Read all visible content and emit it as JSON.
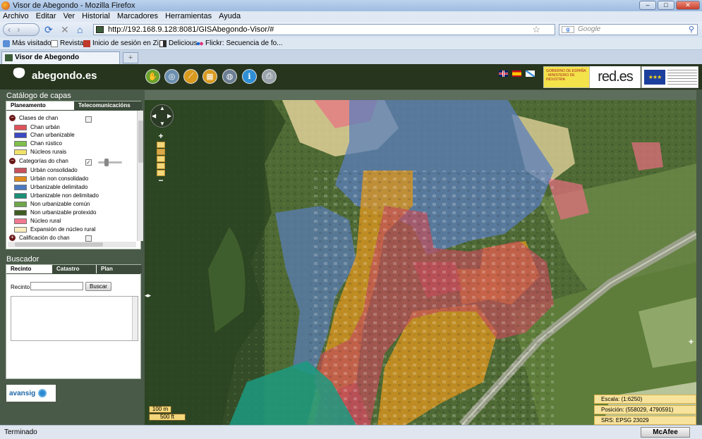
{
  "window": {
    "title": "Visor de Abegondo - Mozilla Firefox",
    "min": "–",
    "max": "□",
    "close": "✕"
  },
  "menu": [
    "Archivo",
    "Editar",
    "Ver",
    "Historial",
    "Marcadores",
    "Herramientas",
    "Ayuda"
  ],
  "nav": {
    "back_forward": "‹ ›",
    "reload": "⟳",
    "stop": "✕",
    "home": "⌂",
    "url": "http://192.168.9.128:8081/GISAbegondo-Visor/#",
    "star": "☆",
    "search_placeholder": "Google",
    "search_icon": "⚲"
  },
  "bookmarks": [
    {
      "label": "Más visitados",
      "icon": "bookmark-icon",
      "color": "#5b8fd6"
    },
    {
      "label": "Revistas",
      "icon": "page-icon",
      "color": "#eeeeee"
    },
    {
      "label": "Inicio de sesión en Zi...",
      "icon": "zimbra-icon",
      "color": "#c0392b"
    },
    {
      "label": "Delicious",
      "icon": "delicious-icon",
      "color": "#2a2a2a"
    },
    {
      "label": "Flickr: Secuencia de fo...",
      "icon": "flickr-icon",
      "color": "#e0317c"
    }
  ],
  "tab": {
    "label": "Visor de Abegondo",
    "new_tab": "+"
  },
  "app": {
    "logo": "abegondo.es",
    "tools": [
      {
        "name": "pan-hand-tool",
        "color": "#6aa32d",
        "glyph": "✋"
      },
      {
        "name": "overview-tool",
        "color": "#6c8faf",
        "glyph": "◎"
      },
      {
        "name": "measure-line-tool",
        "color": "#d99a1e",
        "glyph": "⟋"
      },
      {
        "name": "measure-area-tool",
        "color": "#d99a1e",
        "glyph": "▦"
      },
      {
        "name": "globe-tool",
        "color": "#6c7f94",
        "glyph": "◍"
      },
      {
        "name": "info-tool",
        "color": "#2f8fd6",
        "glyph": "i"
      },
      {
        "name": "print-tool",
        "color": "#9aa3ab",
        "glyph": "⎙"
      }
    ],
    "sponsor_gob": "GOBIERNO DE ESPAÑA · MINISTERIO DE INDUSTRIA",
    "sponsor_redes": "red.es",
    "sponsor_eu_stars": "★★★"
  },
  "catalog": {
    "title": "Catálogo de capas",
    "tabs": [
      "Planeamento",
      "Telecomunicacións"
    ],
    "groups": [
      {
        "label": "Clases de chan",
        "checked": false,
        "items": [
          {
            "label": "Chan urbán",
            "color": "#e0525a"
          },
          {
            "label": "Chan urbanizable",
            "color": "#3b49c4"
          },
          {
            "label": "Chan rústico",
            "color": "#7fc04a"
          },
          {
            "label": "Núcleos rurais",
            "color": "#f0e36a"
          }
        ]
      },
      {
        "label": "Categorías do chan",
        "checked": true,
        "items": [
          {
            "label": "Urbán consolidado",
            "color": "#c9515a"
          },
          {
            "label": "Urbán non consolidado",
            "color": "#e08a1c"
          },
          {
            "label": "Urbanizable delimitado",
            "color": "#4a79c0"
          },
          {
            "label": "Urbanizable non delimitado",
            "color": "#1a8f76"
          },
          {
            "label": "Non urbanizable común",
            "color": "#6fa64a"
          },
          {
            "label": "Non urbanizable protexido",
            "color": "#3d5c22"
          },
          {
            "label": "Núcleo rural",
            "color": "#f07890"
          },
          {
            "label": "Expansión de núcleo rural",
            "color": "#fbeec0"
          }
        ]
      },
      {
        "label": "Calificación do chan",
        "checked": false,
        "items": []
      }
    ]
  },
  "search": {
    "title": "Buscador",
    "tabs": [
      "Recinto",
      "Catastro",
      "Plan"
    ],
    "field_label": "Recinto",
    "field_value": "",
    "button": "Buscar"
  },
  "brand": {
    "label": "avansig"
  },
  "map": {
    "collapse": "◂▸",
    "pan_glyphs": {
      "up": "▲",
      "down": "▼",
      "left": "◀",
      "right": "▶"
    },
    "zoom_in": "+",
    "zoom_out": "−",
    "zoom_level_fraction": 0.5,
    "scale_m": "100 m",
    "scale_ft": "500 ft",
    "escala": "Escala: (1:6250)",
    "posicion": "Posición: (558029, 4790591)",
    "srs": "SRS: EPSG 23029",
    "expand": "+"
  },
  "status": {
    "text": "Terminado",
    "mcafee": "McAfee"
  }
}
